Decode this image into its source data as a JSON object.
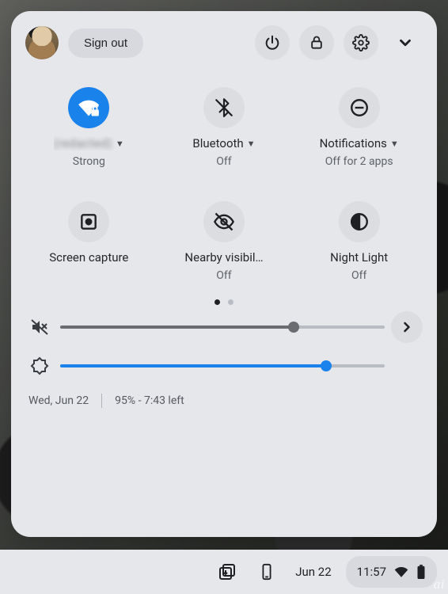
{
  "header": {
    "signout": "Sign out"
  },
  "tiles": [
    {
      "label": "(redacted)",
      "sub": "Strong",
      "active": true
    },
    {
      "label": "Bluetooth",
      "sub": "Off",
      "active": false
    },
    {
      "label": "Notifications",
      "sub": "Off for 2 apps",
      "active": false
    },
    {
      "label": "Screen capture",
      "sub": "",
      "active": false
    },
    {
      "label": "Nearby visibil…",
      "sub": "Off",
      "active": false
    },
    {
      "label": "Night Light",
      "sub": "Off",
      "active": false
    }
  ],
  "pager": {
    "pages": 2,
    "current": 0
  },
  "sliders": {
    "volume": 72,
    "brightness": 82
  },
  "footer": {
    "date": "Wed, Jun 22",
    "battery": "95% - 7:43 left"
  },
  "shelf": {
    "date": "Jun 22",
    "clock": "11:57"
  },
  "watermark": "ai"
}
